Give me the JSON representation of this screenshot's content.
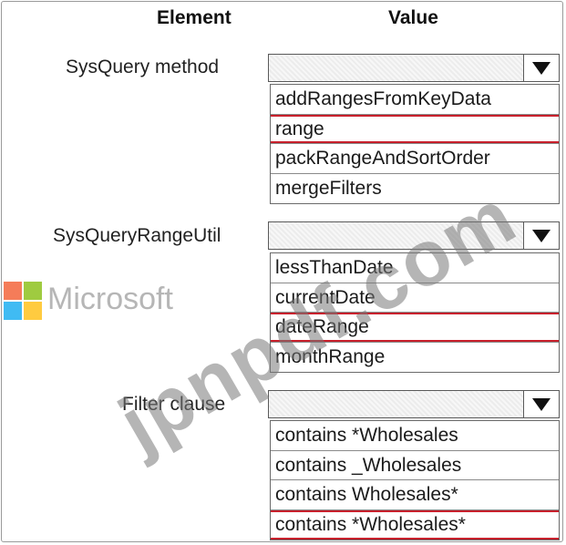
{
  "headers": {
    "element": "Element",
    "value": "Value"
  },
  "rows": [
    {
      "label": "SysQuery method",
      "options": [
        "addRangesFromKeyData",
        "range",
        "packRangeAndSortOrder",
        "mergeFilters"
      ],
      "selected_index": 1
    },
    {
      "label": "SysQueryRangeUtil",
      "options": [
        "lessThanDate",
        "currentDate",
        "dateRange",
        "monthRange"
      ],
      "selected_index": 2
    },
    {
      "label": "Filter clause",
      "options": [
        "contains *Wholesales",
        "contains _Wholesales",
        "contains Wholesales*",
        "contains *Wholesales*"
      ],
      "selected_index": 3
    }
  ],
  "watermarks": {
    "microsoft": "Microsoft",
    "site": "jpnpdf.com"
  },
  "colors": {
    "selection_border": "#c8202c",
    "ms_red": "#f25022",
    "ms_green": "#7fba00",
    "ms_blue": "#00a4ef",
    "ms_yellow": "#ffb900"
  },
  "icons": {
    "dropdown": "triangle-down-icon"
  }
}
